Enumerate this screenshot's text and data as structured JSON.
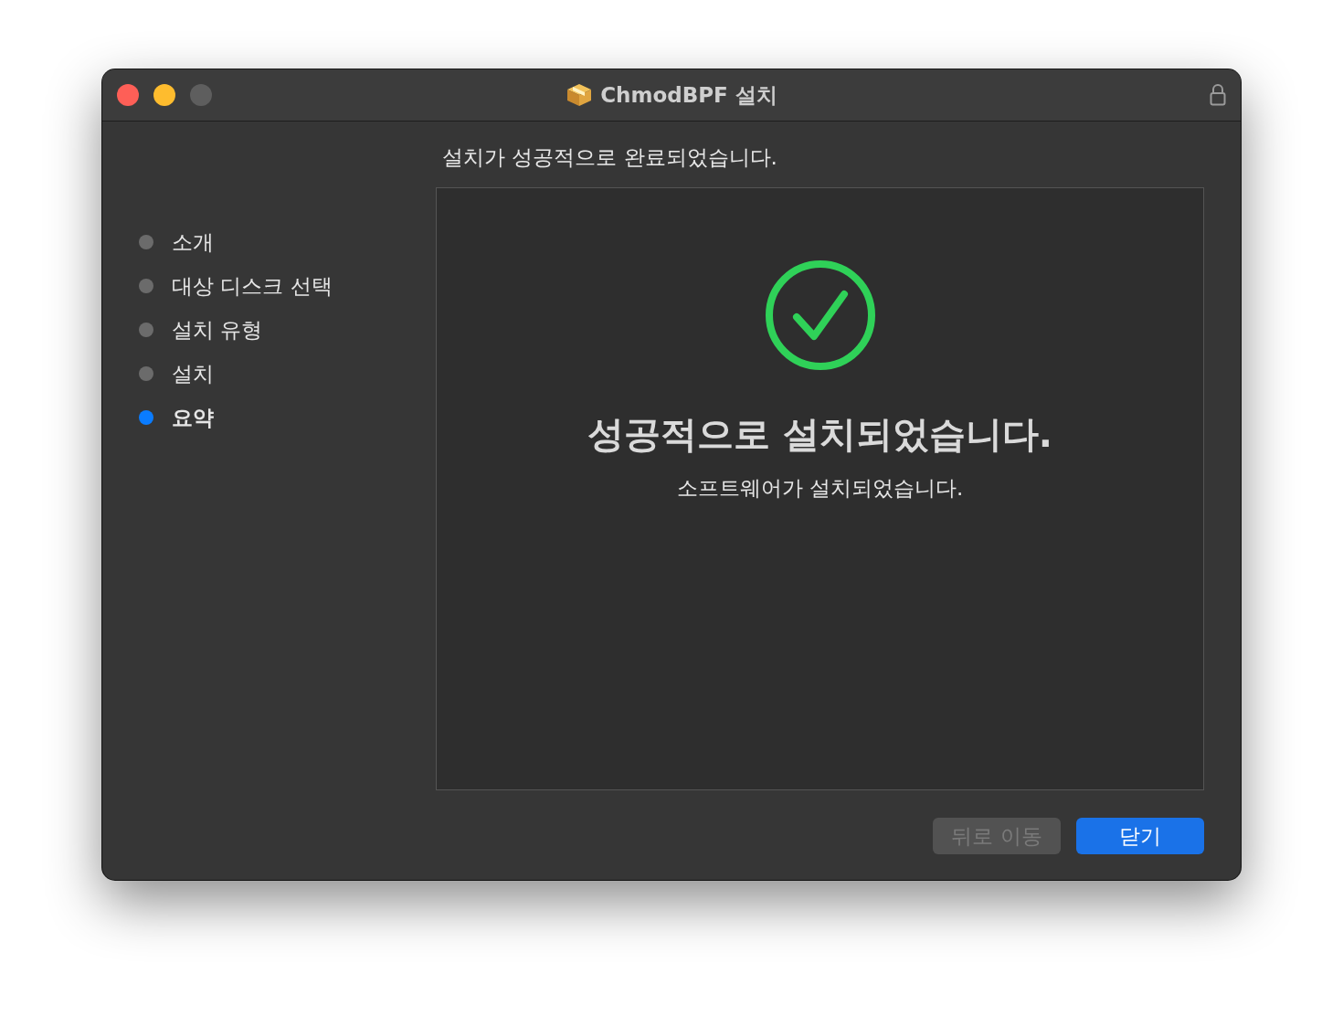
{
  "window": {
    "title": "ChmodBPF 설치"
  },
  "header": "설치가 성공적으로 완료되었습니다.",
  "steps": [
    {
      "label": "소개",
      "selected": false
    },
    {
      "label": "대상 디스크 선택",
      "selected": false
    },
    {
      "label": "설치 유형",
      "selected": false
    },
    {
      "label": "설치",
      "selected": false
    },
    {
      "label": "요약",
      "selected": true
    }
  ],
  "result": {
    "title": "성공적으로 설치되었습니다.",
    "message": "소프트웨어가 설치되었습니다."
  },
  "buttons": [
    {
      "label": "뒤로 이동",
      "disabled": true,
      "kind": "secondary"
    },
    {
      "label": "닫기",
      "disabled": false,
      "kind": "primary"
    }
  ]
}
